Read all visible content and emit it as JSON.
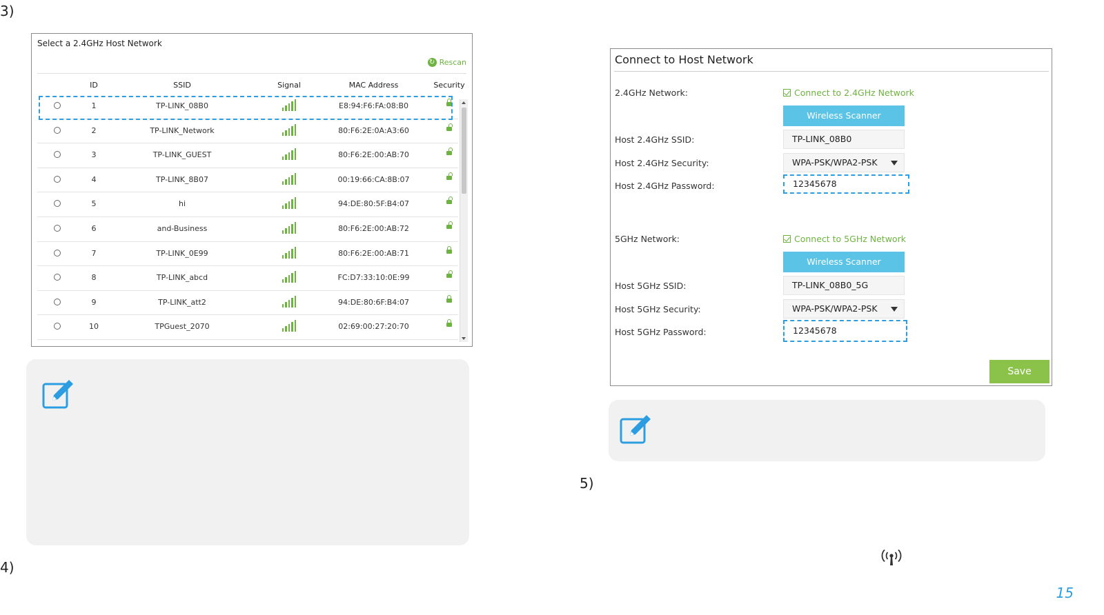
{
  "steps": {
    "s3": "3)",
    "s4": "4)",
    "s5": "5)"
  },
  "scanner": {
    "title": "Select a 2.4GHz Host Network",
    "rescan": "Rescan",
    "columns": [
      "ID",
      "SSID",
      "Signal",
      "MAC Address",
      "Security"
    ],
    "rows": [
      {
        "id": "1",
        "ssid": "TP-LINK_08B0",
        "mac": "E8:94:F6:FA:08:B0",
        "lock": "closed"
      },
      {
        "id": "2",
        "ssid": "TP-LINK_Network",
        "mac": "80:F6:2E:0A:A3:60",
        "lock": "open"
      },
      {
        "id": "3",
        "ssid": "TP-LINK_GUEST",
        "mac": "80:F6:2E:00:AB:70",
        "lock": "open"
      },
      {
        "id": "4",
        "ssid": "TP-LINK_8B07",
        "mac": "00:19:66:CA:8B:07",
        "lock": "open"
      },
      {
        "id": "5",
        "ssid": "hi",
        "mac": "94:DE:80:5F:B4:07",
        "lock": "open"
      },
      {
        "id": "6",
        "ssid": "and-Business",
        "mac": "80:F6:2E:00:AB:72",
        "lock": "open"
      },
      {
        "id": "7",
        "ssid": "TP-LINK_0E99",
        "mac": "80:F6:2E:00:AB:71",
        "lock": "closed"
      },
      {
        "id": "8",
        "ssid": "TP-LINK_abcd",
        "mac": "FC:D7:33:10:0E:99",
        "lock": "open"
      },
      {
        "id": "9",
        "ssid": "TP-LINK_att2",
        "mac": "94:DE:80:6F:B4:07",
        "lock": "closed"
      },
      {
        "id": "10",
        "ssid": "TPGuest_2070",
        "mac": "02:69:00:27:20:70",
        "lock": "closed"
      }
    ]
  },
  "form": {
    "title": "Connect to Host Network",
    "net24_label": "2.4GHz Network:",
    "net24_check": "Connect to 2.4GHz Network",
    "scanner_btn": "Wireless Scanner",
    "ssid24_label": "Host 2.4GHz SSID:",
    "ssid24_value": "TP-LINK_08B0",
    "sec24_label": "Host 2.4GHz Security:",
    "sec24_value": "WPA-PSK/WPA2-PSK",
    "pw24_label": "Host 2.4GHz Password:",
    "pw24_value": "12345678",
    "net5_label": "5GHz Network:",
    "net5_check": "Connect to 5GHz Network",
    "ssid5_label": "Host 5GHz SSID:",
    "ssid5_value": "TP-LINK_08B0_5G",
    "sec5_label": "Host 5GHz Security:",
    "sec5_value": "WPA-PSK/WPA2-PSK",
    "pw5_label": "Host 5GHz Password:",
    "pw5_value": "12345678",
    "save": "Save"
  },
  "page_number": "15",
  "colors": {
    "accent_blue": "#2c9de0",
    "green": "#6db33f",
    "scan_btn": "#5bc4e6",
    "save_btn": "#8bc34a"
  }
}
